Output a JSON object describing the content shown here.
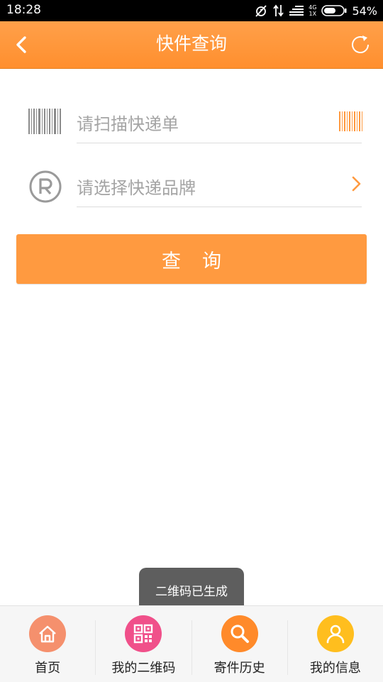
{
  "status_bar": {
    "time": "18:28",
    "network_label": "4G",
    "network_sub": "1X",
    "battery": "54%"
  },
  "header": {
    "title": "快件查询",
    "back_icon": "chevron-left-icon",
    "refresh_icon": "refresh-icon"
  },
  "form": {
    "scan_placeholder": "请扫描快递单",
    "brand_placeholder": "请选择快递品牌",
    "query_label": "查询"
  },
  "toast": {
    "message": "二维码已生成"
  },
  "bottom_nav": {
    "items": [
      {
        "label": "首页",
        "icon": "home-icon",
        "color": "#f5906d"
      },
      {
        "label": "我的二维码",
        "icon": "qrcode-icon",
        "color": "#f0508a"
      },
      {
        "label": "寄件历史",
        "icon": "search-icon",
        "color": "#ff8a2a"
      },
      {
        "label": "我的信息",
        "icon": "user-icon",
        "color": "#ffbe1e"
      }
    ]
  },
  "colors": {
    "accent": "#ff9a40",
    "header": "#ff942f"
  }
}
